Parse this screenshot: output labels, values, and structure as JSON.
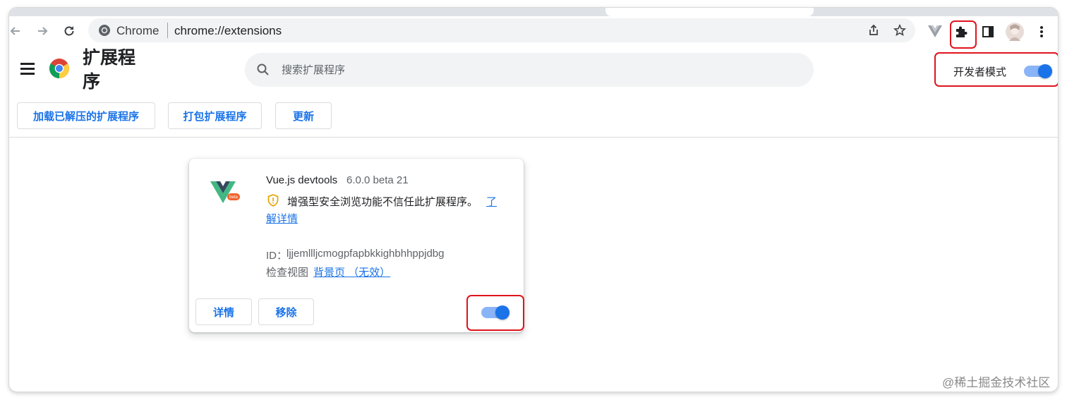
{
  "browser": {
    "site_name": "Chrome",
    "url": "chrome://extensions",
    "icons": {
      "back": "arrow-left-icon",
      "forward": "arrow-right-icon",
      "reload": "reload-icon",
      "share": "share-icon",
      "bookmark": "star-icon",
      "vue_ext": "vue-extension-icon",
      "extensions": "puzzle-icon",
      "side_panel": "side-panel-icon",
      "profile": "avatar",
      "menu": "more-vert-icon"
    }
  },
  "header": {
    "title": "扩展程序",
    "search_placeholder": "搜索扩展程序",
    "dev_mode_label": "开发者模式",
    "dev_mode_on": true
  },
  "actions": {
    "load_unpacked": "加载已解压的扩展程序",
    "pack": "打包扩展程序",
    "update": "更新"
  },
  "extension": {
    "name": "Vue.js devtools",
    "version": "6.0.0 beta 21",
    "warning_text": "增强型安全浏览功能不信任此扩展程序。",
    "warning_link_part1": "了",
    "warning_link_part2": "解详情",
    "id_label": "ID：",
    "id_value": "ljjemllljcmogpfapbkkighbhhppjdbg",
    "inspect_label": "检查视图",
    "inspect_link": "背景页 （无效）",
    "details_button": "详情",
    "remove_button": "移除",
    "enabled": true
  },
  "watermark": "@稀土掘金技术社区",
  "colors": {
    "accent": "#1a73e8",
    "toggle_track": "#8ab4f8",
    "highlight_red": "#e0141e"
  }
}
